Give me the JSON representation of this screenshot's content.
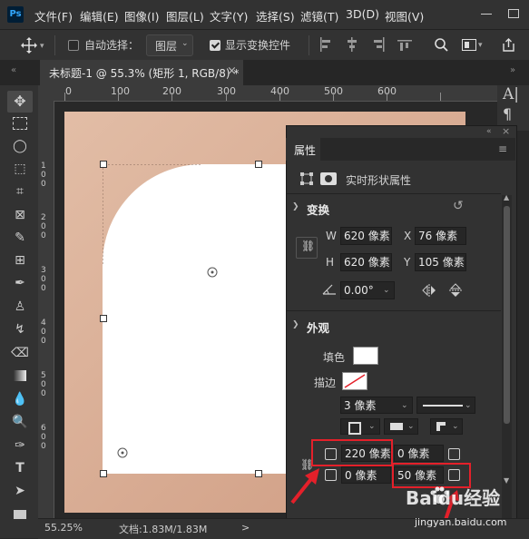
{
  "app": {
    "logo": "Ps"
  },
  "menubar": {
    "items": [
      "文件(F)",
      "编辑(E)",
      "图像(I)",
      "图层(L)",
      "文字(Y)",
      "选择(S)",
      "滤镜(T)",
      "3D(D)",
      "视图(V)"
    ]
  },
  "options": {
    "auto_select_label": "自动选择：",
    "auto_select_checked": false,
    "layer_dropdown": "图层",
    "show_transform_label": "显示变换控件",
    "show_transform_checked": true
  },
  "document": {
    "tab_title": "未标题-1 @ 55.3% (矩形 1, RGB/8) *",
    "close_glyph": "×"
  },
  "rulers": {
    "top_labels": [
      "0",
      "100",
      "200",
      "300",
      "400",
      "500",
      "600"
    ],
    "left_labels": [
      "1\n0\n0",
      "2\n0\n0",
      "3\n0\n0",
      "4\n0\n0",
      "5\n0\n0",
      "6\n0\n0"
    ]
  },
  "properties": {
    "tab_label": "属性",
    "subtitle": "实时形状属性",
    "transform": {
      "title": "变换",
      "w_label": "W",
      "w_value": "620 像素",
      "x_label": "X",
      "x_value": "76 像素",
      "h_label": "H",
      "h_value": "620 像素",
      "y_label": "Y",
      "y_value": "105 像素",
      "angle_value": "0.00°"
    },
    "appearance": {
      "title": "外观",
      "fill_label": "填色",
      "fill_color": "#ffffff",
      "stroke_label": "描边",
      "stroke_width": "3 像素",
      "corners": {
        "top_left": "220 像素",
        "top_right": "0 像素",
        "bottom_left": "0 像素",
        "bottom_right": "50 像素"
      }
    }
  },
  "status": {
    "zoom": "55.25%",
    "doc_info": "文档:1.83M/1.83M",
    "arrow": ">"
  },
  "watermark": {
    "line1": "Baidu经验",
    "line2": "jingyan.baidu.com"
  },
  "colors": {
    "highlight_red": "#e4202a",
    "accent_blue": "#31a8ff"
  }
}
